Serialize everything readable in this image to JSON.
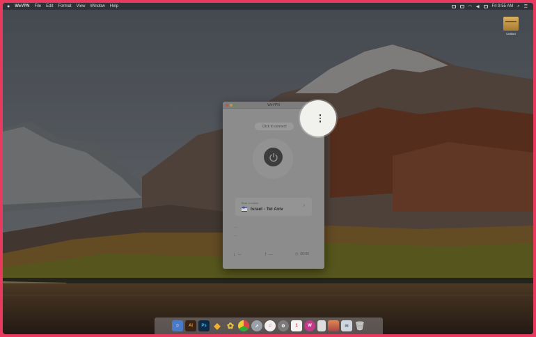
{
  "menubar": {
    "apple": "",
    "app_name": "WeVPN",
    "items": [
      "File",
      "Edit",
      "Format",
      "View",
      "Window",
      "Help"
    ],
    "clock": "Fri 9:55 AM"
  },
  "desktop_icon": {
    "label": "Untitled"
  },
  "window": {
    "title": "WeVPN",
    "connect_label": "Click to connect",
    "location": {
      "subtitle": "Best Location",
      "name": "Israel - Tel Aviv"
    },
    "stats": {
      "download": "—",
      "upload": "—",
      "time": "00:00"
    }
  },
  "dock_apps": [
    "finder-icon",
    "illustrator-icon",
    "photoshop-icon",
    "sketch-icon",
    "app-icon",
    "chrome-icon",
    "launchpad-icon",
    "itunes-icon",
    "preferences-icon",
    "calendar-icon",
    "wevpn-icon",
    "document-icon",
    "tv-icon",
    "mail-icon",
    "trash-icon"
  ]
}
